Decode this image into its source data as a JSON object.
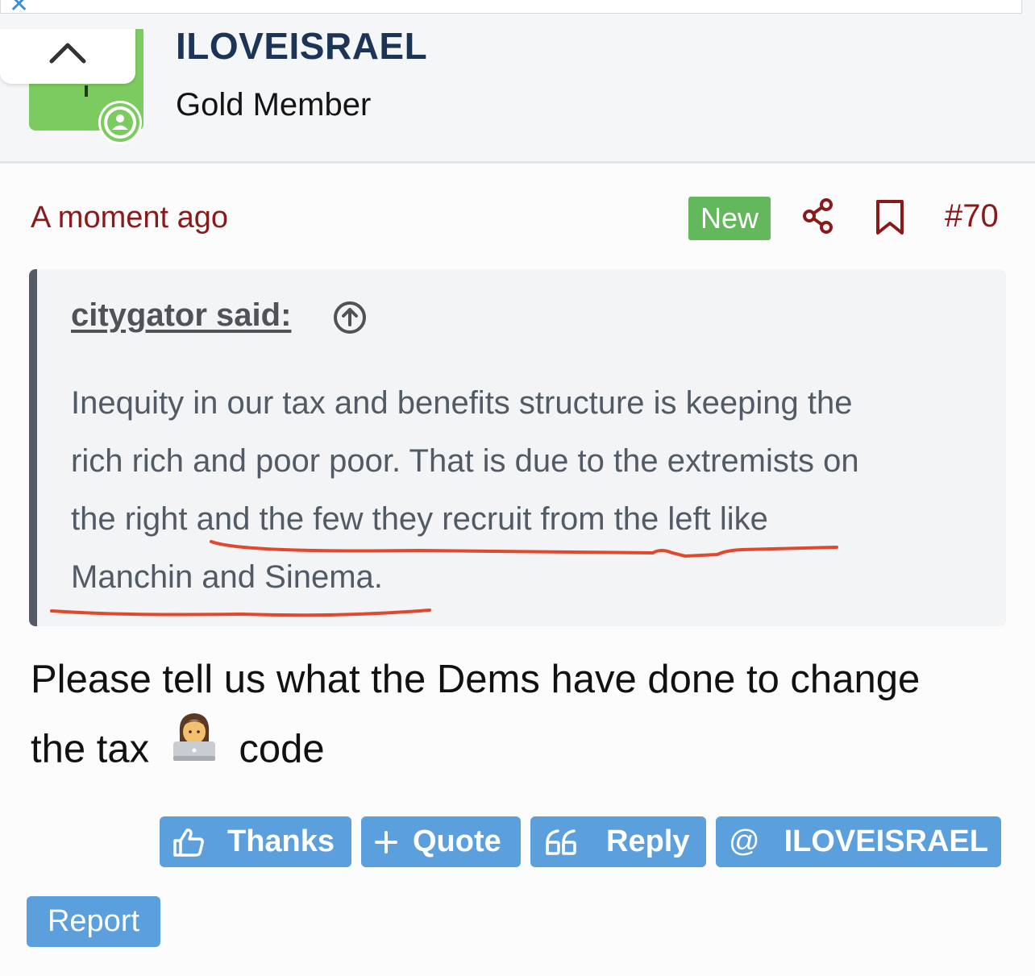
{
  "header": {
    "username": "ILOVEISRAEL",
    "user_title": "Gold Member"
  },
  "post": {
    "time": "A moment ago",
    "badge": "New",
    "number": "#70",
    "quote": {
      "author": "citygator said:",
      "lines": [
        "Inequity in our tax and benefits structure is keeping the",
        "rich rich and poor poor. That is due to the extremists on",
        "the right and the few they recruit from the left like",
        "Manchin and Sinema."
      ]
    },
    "body": {
      "line1": "Please tell us what the Dems have done to change",
      "line2_before": "the tax",
      "line2_emoji": "technologist-emoji",
      "line2_after": "code"
    },
    "actions": {
      "thanks": "Thanks",
      "quote": "Quote",
      "reply": "Reply",
      "mention": "ILOVEISRAEL",
      "report": "Report"
    }
  },
  "colors": {
    "accent_button": "#5b9fdc",
    "new_badge": "#63b85c",
    "post_meta": "#8a1a1a",
    "username": "#1c3557",
    "annotation": "#e0492c",
    "avatar_bg": "#7ccb60"
  },
  "icons": [
    "close-icon",
    "chevron-up-icon",
    "online-user-icon",
    "share-icon",
    "bookmark-icon",
    "arrow-up-circle-icon",
    "thumbs-up-icon",
    "plus-icon",
    "quote-marks-icon",
    "at-icon"
  ]
}
